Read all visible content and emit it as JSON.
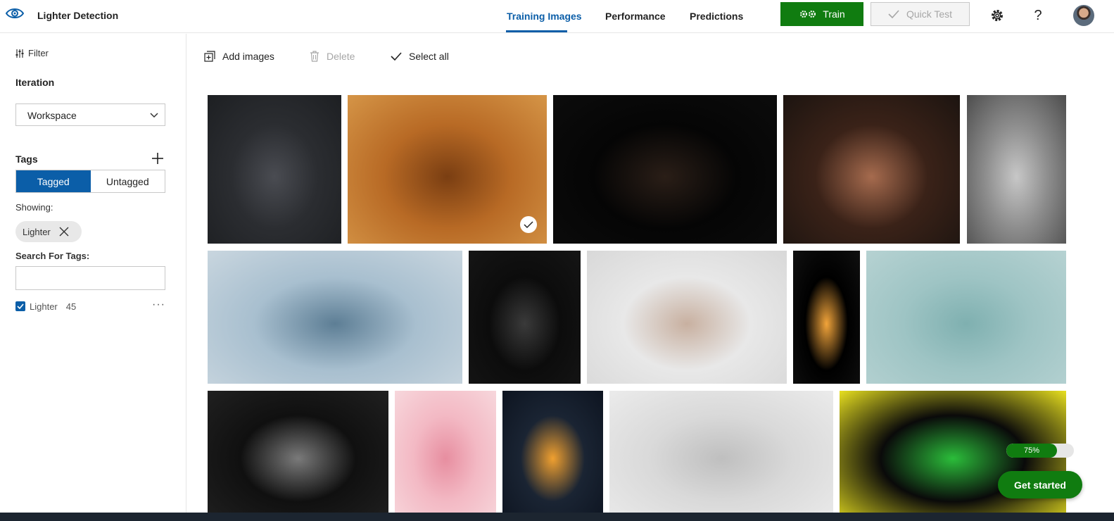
{
  "app": {
    "title": "Lighter Detection"
  },
  "tabs": [
    {
      "label": "Training Images",
      "active": true
    },
    {
      "label": "Performance",
      "active": false
    },
    {
      "label": "Predictions",
      "active": false
    }
  ],
  "header_buttons": {
    "train": "Train",
    "quick_test": "Quick Test",
    "help": "?"
  },
  "sidebar": {
    "filter_label": "Filter",
    "iteration_heading": "Iteration",
    "iteration_value": "Workspace",
    "tags_heading": "Tags",
    "tagged_label": "Tagged",
    "untagged_label": "Untagged",
    "showing_label": "Showing:",
    "active_filter": "Lighter",
    "search_label": "Search For Tags:",
    "search_value": "",
    "tag_list": [
      {
        "name": "Lighter",
        "count": "45",
        "checked": true
      }
    ]
  },
  "toolbar": {
    "add_images": "Add images",
    "delete": "Delete",
    "select_all": "Select all"
  },
  "gallery": [
    {
      "name": "image-1",
      "colors": [
        "#2b2d31",
        "#4a4c52",
        "#1d1f22"
      ]
    },
    {
      "name": "image-2",
      "colors": [
        "#b86a25",
        "#7a3e12",
        "#d59547"
      ],
      "selected": true
    },
    {
      "name": "image-3",
      "colors": [
        "#050505",
        "#2a1e17",
        "#0c0c0c"
      ]
    },
    {
      "name": "image-4",
      "colors": [
        "#3a2218",
        "#a66b4e",
        "#1c1410"
      ]
    },
    {
      "name": "image-5",
      "colors": [
        "#8d8d8d",
        "#c7c7c7",
        "#4d4d4d"
      ]
    },
    {
      "name": "image-6",
      "colors": [
        "#a8bfcf",
        "#5d7e95",
        "#c9d6df"
      ]
    },
    {
      "name": "image-7",
      "colors": [
        "#0c0c0c",
        "#3a3a3a",
        "#151515"
      ]
    },
    {
      "name": "image-8",
      "colors": [
        "#e8e8e8",
        "#c8b0a0",
        "#d8d8d8"
      ]
    },
    {
      "name": "image-9",
      "colors": [
        "#000000",
        "#f2a43a",
        "#101010"
      ]
    },
    {
      "name": "image-10",
      "colors": [
        "#9ec4c4",
        "#7fb0b0",
        "#b6d2d2"
      ]
    },
    {
      "name": "image-11",
      "colors": [
        "#101010",
        "#7a7a7a",
        "#202020"
      ]
    },
    {
      "name": "image-12",
      "colors": [
        "#f3b9c4",
        "#e78ea0",
        "#f7d7dc"
      ]
    },
    {
      "name": "image-13",
      "colors": [
        "#1a2433",
        "#f0a030",
        "#0d1420"
      ]
    },
    {
      "name": "image-14",
      "colors": [
        "#d9d9d9",
        "#bfbfbf",
        "#ebebeb"
      ]
    },
    {
      "name": "image-15",
      "colors": [
        "#0a0a0a",
        "#2bbd3a",
        "#e8e020"
      ]
    }
  ],
  "onboarding": {
    "progress": "75%",
    "progress_value": 0.75,
    "get_started": "Get started"
  },
  "colors": {
    "accent": "#0b5ea8",
    "train_green": "#107c10"
  }
}
